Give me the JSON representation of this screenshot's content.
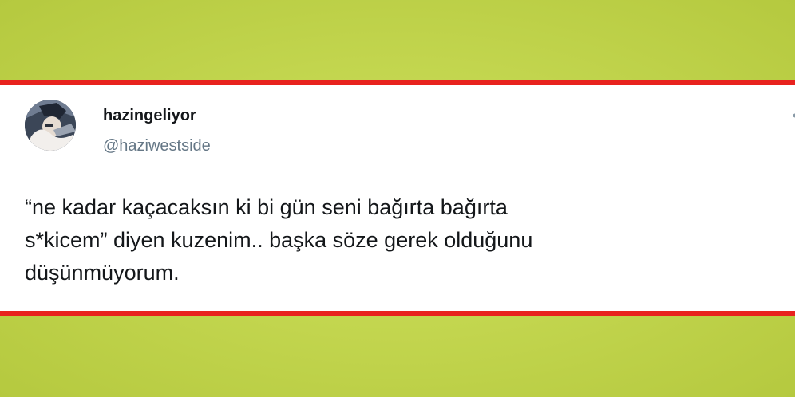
{
  "tweet": {
    "display_name": "hazingeliyor",
    "handle": "@haziwestside",
    "lines": [
      "“ne kadar kaçacaksın ki bi gün seni bağırta bağırta",
      "s*kicem” diyen kuzenim.. başka söze gerek olduğunu",
      "düşünmüyorum."
    ]
  },
  "colors": {
    "background": "#c3d64f",
    "frame_red": "#e8221e",
    "card": "#ffffff",
    "name": "#14171a",
    "handle": "#657786"
  },
  "icons": {
    "avatar": "profile-photo",
    "menu": "chevron-down-icon"
  }
}
